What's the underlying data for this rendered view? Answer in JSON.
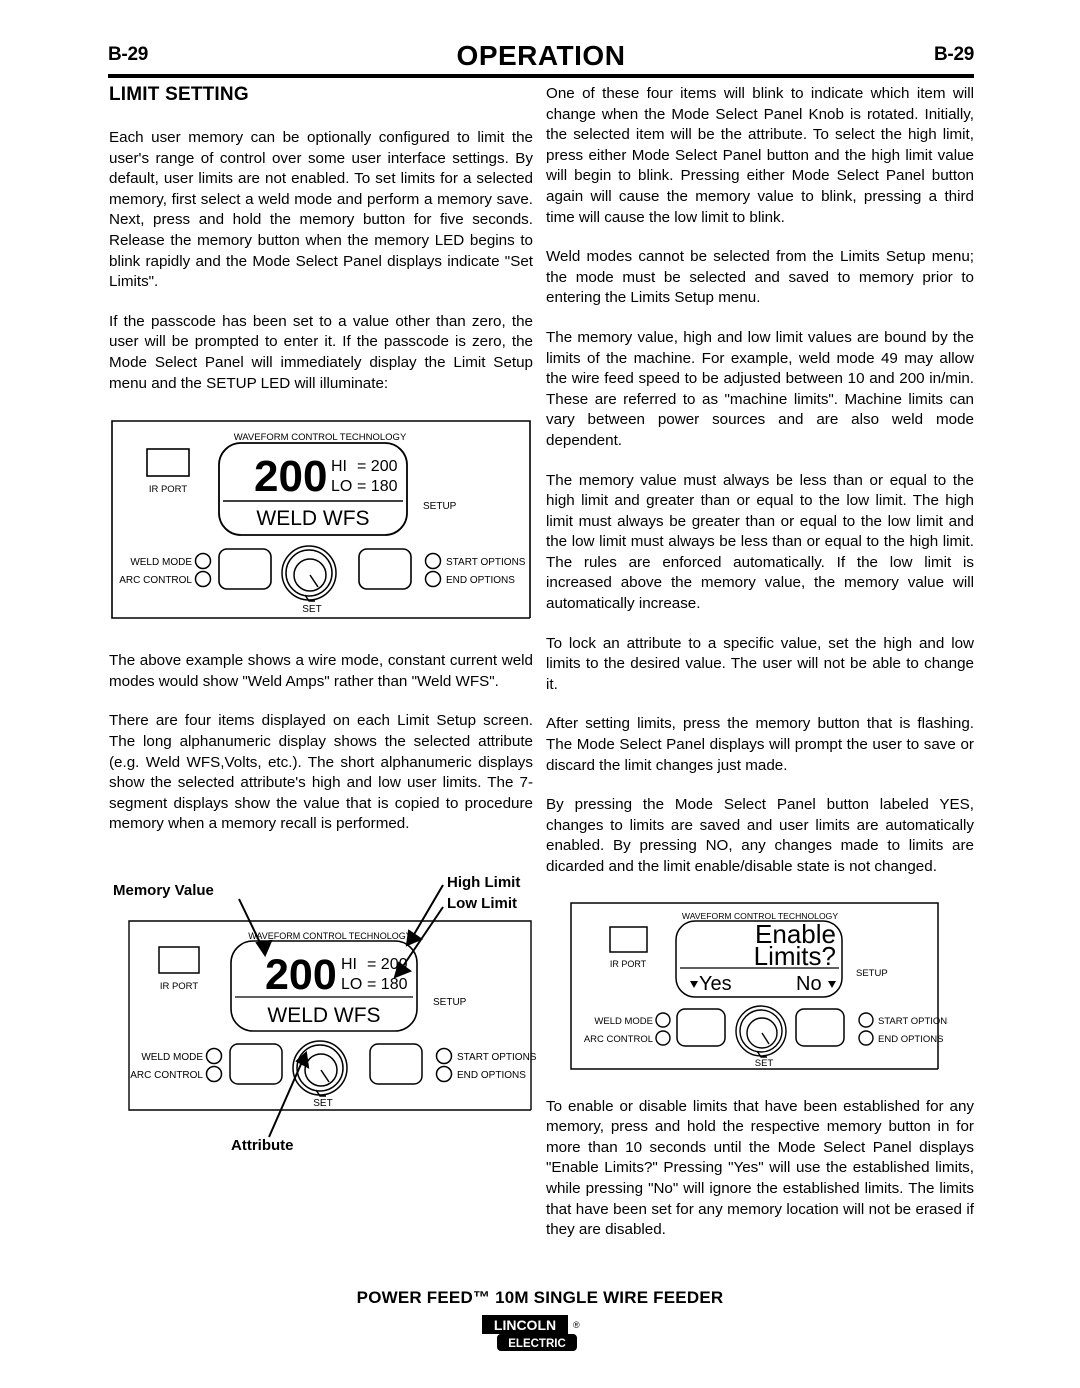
{
  "header": {
    "page_left": "B-29",
    "title": "OPERATION",
    "page_right": "B-29"
  },
  "left_column": {
    "section_title": "LIMIT SETTING",
    "paragraphs": [
      "Each user memory can be optionally configured to limit the user's range of control over some user interface settings.  By default, user limits are not enabled.  To set limits for a selected memory, first select a weld mode and perform a memory save.  Next, press and hold the memory button for five seconds.  Release the memory button when the memory LED begins to blink rapidly and the Mode Select Panel displays indicate \"Set Limits\".",
      "If the passcode has been set to a value other than zero, the user will be prompted to enter it.  If the passcode is zero, the Mode Select Panel will immediately display the Limit Setup menu and the SETUP LED will illuminate:",
      "The above example shows a wire mode, constant current weld modes would show \"Weld Amps\" rather than \"Weld WFS\".",
      "There are four items displayed on each Limit Setup screen.  The long alphanumeric display shows the selected attribute (e.g. Weld WFS,Volts, etc.).  The short alphanumeric displays show the selected attribute's high and low user limits. The 7-segment displays show the value that is copied to procedure memory when a memory recall is performed."
    ]
  },
  "right_column": {
    "paragraphs": [
      "One of these four items will blink to indicate which item will change when the Mode Select Panel Knob is rotated. Initially, the selected item will be the attribute.  To select the high limit, press either Mode Select Panel button and the high limit value will begin to blink. Pressing either Mode Select Panel button again will cause the memory value to blink, pressing a third time will cause the low limit to blink.",
      "Weld modes cannot be selected from the Limits Setup menu; the mode must be selected and saved to memory prior to entering the Limits Setup menu.",
      "The memory value, high and low limit values are bound by the limits of the machine.  For example, weld mode 49 may allow the wire feed speed to be adjusted between 10 and 200 in/min. These are referred to as \"machine limits\".  Machine limits can vary between power sources and are also weld mode dependent.",
      "The memory value must always be less than or equal to the high limit and greater than or equal to the low limit. The high limit must always be greater than or equal to the low limit and the low limit must always be less than or equal to the high limit.  The rules are enforced automatically.  If the low limit is increased above the memory value, the memory value will automatically increase.",
      "To lock an attribute to a specific value, set the high and low limits to the desired value.  The user will not be able to change it.",
      "After setting limits, press the memory button that is flashing.  The Mode Select Panel displays will prompt the user to save or discard the limit changes just made.",
      "By pressing the Mode Select Panel button labeled YES, changes to limits are saved and user limits are automatically enabled. By pressing NO, any changes made to limits are dicarded and the limit enable/disable state is not changed.",
      "To enable or disable limits that have been established for any memory, press and hold the respective memory button in for more than 10 seconds until the Mode Select Panel displays \"Enable Limits?\" Pressing \"Yes\" will use the established limits, while pressing \"No\" will ignore the established limits. The limits that have been set for any memory location will not be erased if they are disabled."
    ]
  },
  "panel_common": {
    "brand_line": "WAVEFORM CONTROL TECHNOLOGY",
    "ir_port": "IR PORT",
    "setup_led": "SETUP",
    "weld_mode": "WELD MODE",
    "arc_control": "ARC CONTROL",
    "start_options": "START OPTIONS",
    "end_options": "END OPTIONS",
    "set_knob": "SET"
  },
  "panel_limit_setup": {
    "memory_value": "200",
    "hi_label": "HI",
    "hi_eq": "= 200",
    "lo_label": "LO",
    "lo_eq": "= 180",
    "attribute": "WELD WFS"
  },
  "panel_annotated": {
    "memory_value": "200",
    "hi_label": "HI",
    "hi_eq": "= 200",
    "lo_label": "LO",
    "lo_eq": "= 180",
    "attribute": "WELD WFS",
    "callout_memory_value": "Memory Value",
    "callout_high_limit": "High Limit",
    "callout_low_limit": "Low Limit",
    "callout_attribute": "Attribute"
  },
  "panel_enable_limits": {
    "line1": "Enable",
    "line2": "Limits?",
    "yes": "Yes",
    "no": "No"
  },
  "footer": {
    "product": "POWER FEED™ 10M SINGLE WIRE FEEDER",
    "logo_top": "LINCOLN",
    "logo_reg": "®",
    "logo_bottom": "ELECTRIC"
  }
}
